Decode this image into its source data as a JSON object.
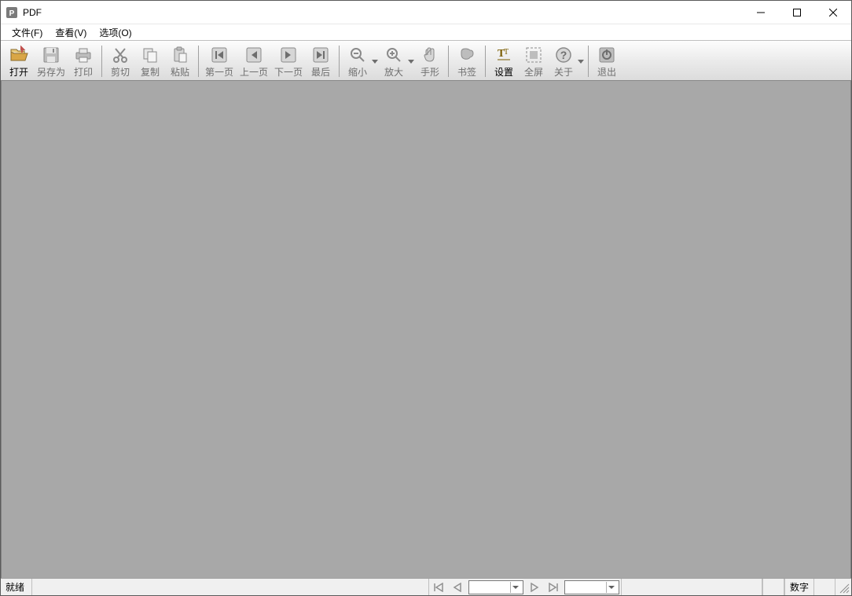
{
  "window": {
    "title": "PDF"
  },
  "menu": {
    "file": "文件(F)",
    "view": "查看(V)",
    "options": "选项(O)"
  },
  "toolbar": {
    "open": "打开",
    "saveas": "另存为",
    "print": "打印",
    "cut": "剪切",
    "copy": "复制",
    "paste": "粘贴",
    "first": "第一页",
    "prev": "上一页",
    "next": "下一页",
    "last": "最后",
    "zoomout": "缩小",
    "zoomin": "放大",
    "hand": "手形",
    "bookmark": "书签",
    "settings": "设置",
    "fullscreen": "全屏",
    "about": "关于",
    "exit": "退出"
  },
  "status": {
    "ready": "就绪",
    "numlock": "数字"
  }
}
